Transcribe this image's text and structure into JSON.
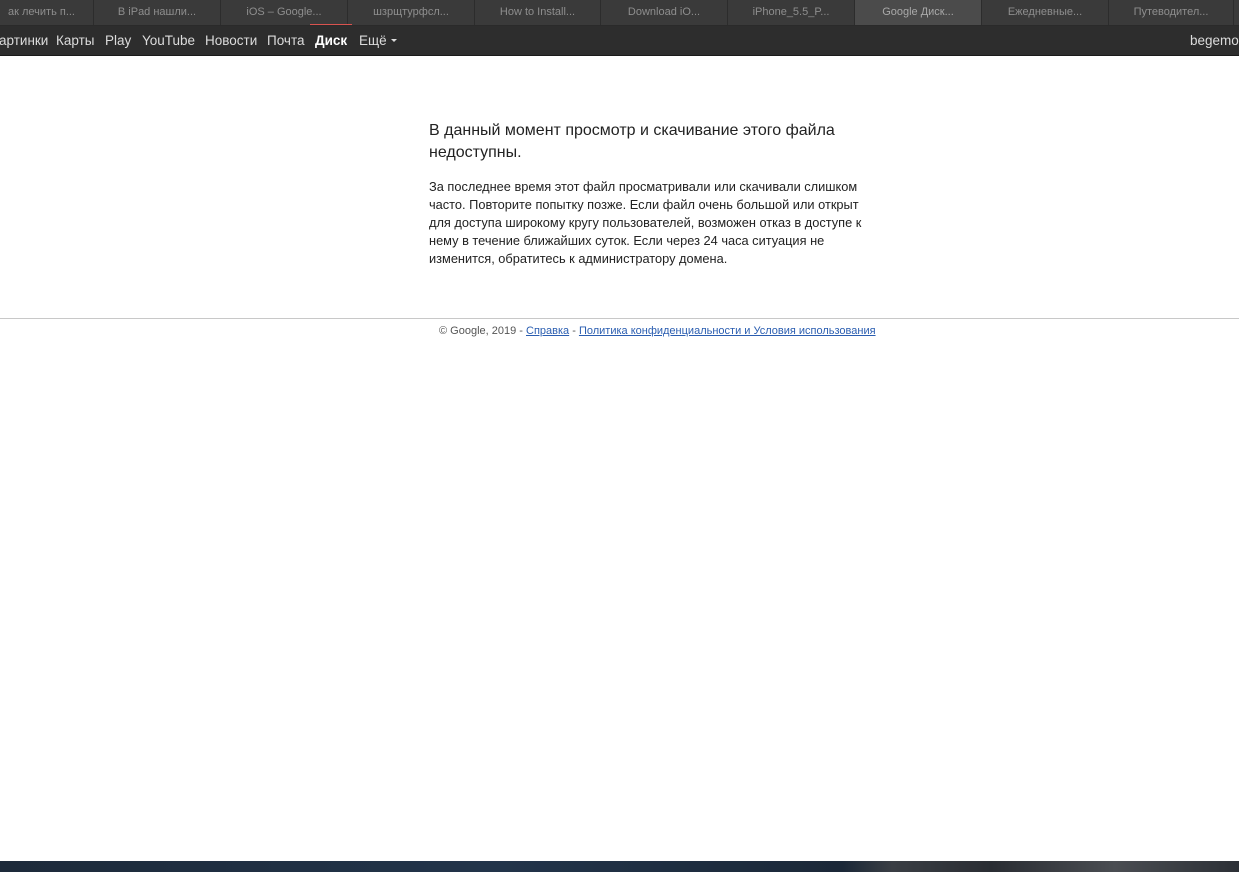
{
  "browser": {
    "tabs": [
      {
        "title": "ак лечить п..."
      },
      {
        "title": "В iPad нашли..."
      },
      {
        "title": "iOS – Google..."
      },
      {
        "title": "шзрщтурфсл..."
      },
      {
        "title": "How to Install..."
      },
      {
        "title": "Download iO..."
      },
      {
        "title": "iPhone_5.5_P..."
      },
      {
        "title": "Google Диск..."
      },
      {
        "title": "Ежедневные..."
      },
      {
        "title": "Путеводител..."
      }
    ],
    "active_tab_index": 7
  },
  "google_bar": {
    "items": [
      {
        "label": "артинки"
      },
      {
        "label": "Карты"
      },
      {
        "label": "Play"
      },
      {
        "label": "YouTube"
      },
      {
        "label": "Новости"
      },
      {
        "label": "Почта"
      },
      {
        "label": "Диск"
      },
      {
        "label": "Ещё"
      }
    ],
    "current_index": 6,
    "account": "begemo"
  },
  "main": {
    "heading": "В данный момент просмотр и скачивание этого файла недоступны.",
    "description": "За последнее время этот файл просматривали или скачивали слишком часто. Повторите попытку позже. Если файл очень большой или открыт для доступа широкому кругу пользователей, возможен отказ в доступе к нему в течение ближайших суток. Если через 24 часа ситуация не изменится, обратитесь к администратору домена."
  },
  "footer": {
    "copyright": "© Google, 2019 - ",
    "help_link": "Справка",
    "separator": " - ",
    "privacy_link": "Политика конфиденциальности и Условия использования"
  },
  "colors": {
    "tab_indicator": "#d9534f",
    "link": "#2a5db0"
  }
}
